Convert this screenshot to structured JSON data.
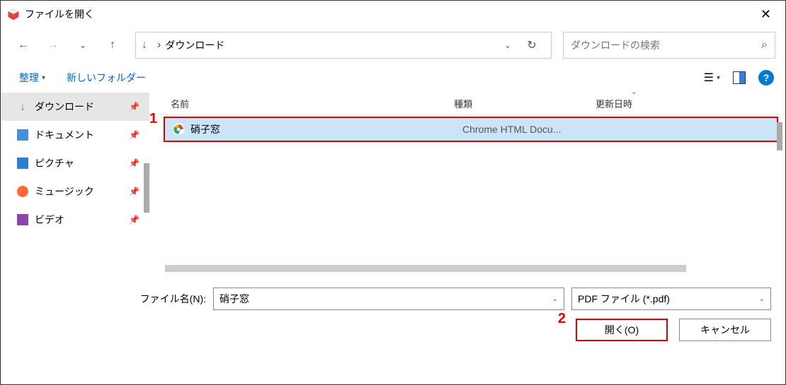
{
  "window": {
    "title": "ファイルを開く"
  },
  "path": {
    "location": "ダウンロード"
  },
  "search": {
    "placeholder": "ダウンロードの検索"
  },
  "toolbar": {
    "organize": "整理",
    "new_folder": "新しいフォルダー"
  },
  "sidebar": [
    {
      "label": "ダウンロード",
      "icon": "download",
      "selected": true
    },
    {
      "label": "ドキュメント",
      "icon": "document",
      "selected": false
    },
    {
      "label": "ピクチャ",
      "icon": "picture",
      "selected": false
    },
    {
      "label": "ミュージック",
      "icon": "music",
      "selected": false
    },
    {
      "label": "ビデオ",
      "icon": "video",
      "selected": false
    }
  ],
  "columns": {
    "name": "名前",
    "type": "種類",
    "modified": "更新日時"
  },
  "files": [
    {
      "name": "硝子窓",
      "type": "Chrome HTML Docu...",
      "modified": ""
    }
  ],
  "footer": {
    "filename_label": "ファイル名(N):",
    "filename_value": "硝子窓",
    "filter": "PDF ファイル (*.pdf)",
    "open": "開く(O)",
    "cancel": "キャンセル"
  },
  "annotations": {
    "one": "1",
    "two": "2"
  }
}
